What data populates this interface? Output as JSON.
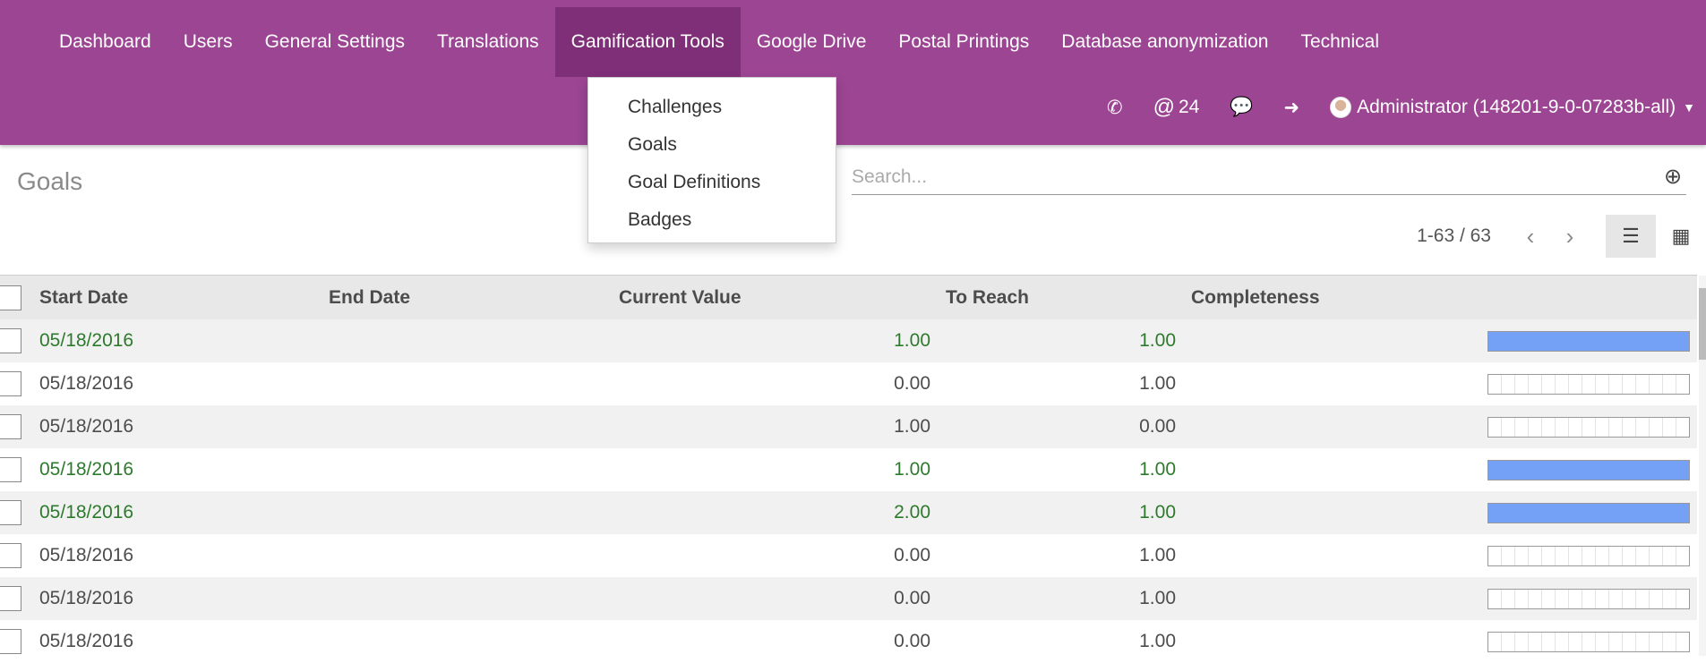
{
  "nav": {
    "items": [
      "Dashboard",
      "Users",
      "General Settings",
      "Translations",
      "Gamification Tools",
      "Google Drive",
      "Postal Printings",
      "Database anonymization",
      "Technical"
    ],
    "active": "Gamification Tools"
  },
  "dropdown": {
    "items": [
      "Challenges",
      "Goals",
      "Goal Definitions",
      "Badges"
    ]
  },
  "systray": {
    "phone_icon": "phone-icon",
    "mentions_icon": "at-icon",
    "mentions_count": "24",
    "chat_icon": "chat-icon",
    "login_icon": "sign-in-icon",
    "user": "Administrator (148201-9-0-07283b-all)"
  },
  "page": {
    "title": "Goals"
  },
  "search": {
    "placeholder": "Search...",
    "value": ""
  },
  "pager": {
    "value": "1-63 / 63"
  },
  "colors": {
    "topbar": "#9c4593",
    "active_nav": "#7f2f77",
    "progress": "#74a0f5",
    "success_text": "#2d7a2d"
  },
  "table": {
    "headers": [
      "Start Date",
      "End Date",
      "Current Value",
      "To Reach",
      "Completeness"
    ],
    "rows": [
      {
        "start": "05/18/2016",
        "end": "",
        "current": "1.00",
        "reach": "1.00",
        "completeness": 100,
        "success": true
      },
      {
        "start": "05/18/2016",
        "end": "",
        "current": "0.00",
        "reach": "1.00",
        "completeness": 0,
        "success": false
      },
      {
        "start": "05/18/2016",
        "end": "",
        "current": "1.00",
        "reach": "0.00",
        "completeness": 0,
        "success": false
      },
      {
        "start": "05/18/2016",
        "end": "",
        "current": "1.00",
        "reach": "1.00",
        "completeness": 100,
        "success": true
      },
      {
        "start": "05/18/2016",
        "end": "",
        "current": "2.00",
        "reach": "1.00",
        "completeness": 100,
        "success": true
      },
      {
        "start": "05/18/2016",
        "end": "",
        "current": "0.00",
        "reach": "1.00",
        "completeness": 0,
        "success": false
      },
      {
        "start": "05/18/2016",
        "end": "",
        "current": "0.00",
        "reach": "1.00",
        "completeness": 0,
        "success": false
      },
      {
        "start": "05/18/2016",
        "end": "",
        "current": "0.00",
        "reach": "1.00",
        "completeness": 0,
        "success": false
      }
    ]
  }
}
